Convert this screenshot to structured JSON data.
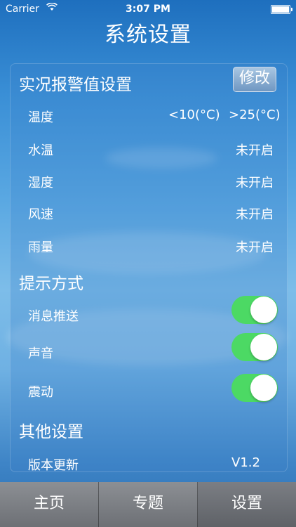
{
  "status_bar": {
    "carrier": "Carrier",
    "time": "3:07 PM",
    "wifi_icon": "wifi-icon",
    "battery_icon": "battery-icon"
  },
  "nav": {
    "title": "系统设置"
  },
  "alarm_section": {
    "title": "实况报警值设置",
    "edit_label": "修改",
    "rows": [
      {
        "label": "温度",
        "value_low": "<10(°C)",
        "value_high": ">25(°C)"
      },
      {
        "label": "水温",
        "value": "未开启"
      },
      {
        "label": "湿度",
        "value": "未开启"
      },
      {
        "label": "风速",
        "value": "未开启"
      },
      {
        "label": "雨量",
        "value": "未开启"
      }
    ]
  },
  "notify_section": {
    "title": "提示方式",
    "rows": [
      {
        "label": "消息推送",
        "on": true
      },
      {
        "label": "声音",
        "on": true
      },
      {
        "label": "震动",
        "on": true
      }
    ]
  },
  "other_section": {
    "title": "其他设置",
    "rows": [
      {
        "label": "版本更新",
        "value": "V1.2"
      }
    ]
  },
  "tabbar": {
    "tabs": [
      {
        "label": "主页"
      },
      {
        "label": "专题"
      },
      {
        "label": "设置"
      }
    ],
    "active": "设置"
  },
  "colors": {
    "toggle_on": "#4cd964",
    "sky_top": "#1e6fbe",
    "sky_mid": "#7dbde9"
  }
}
